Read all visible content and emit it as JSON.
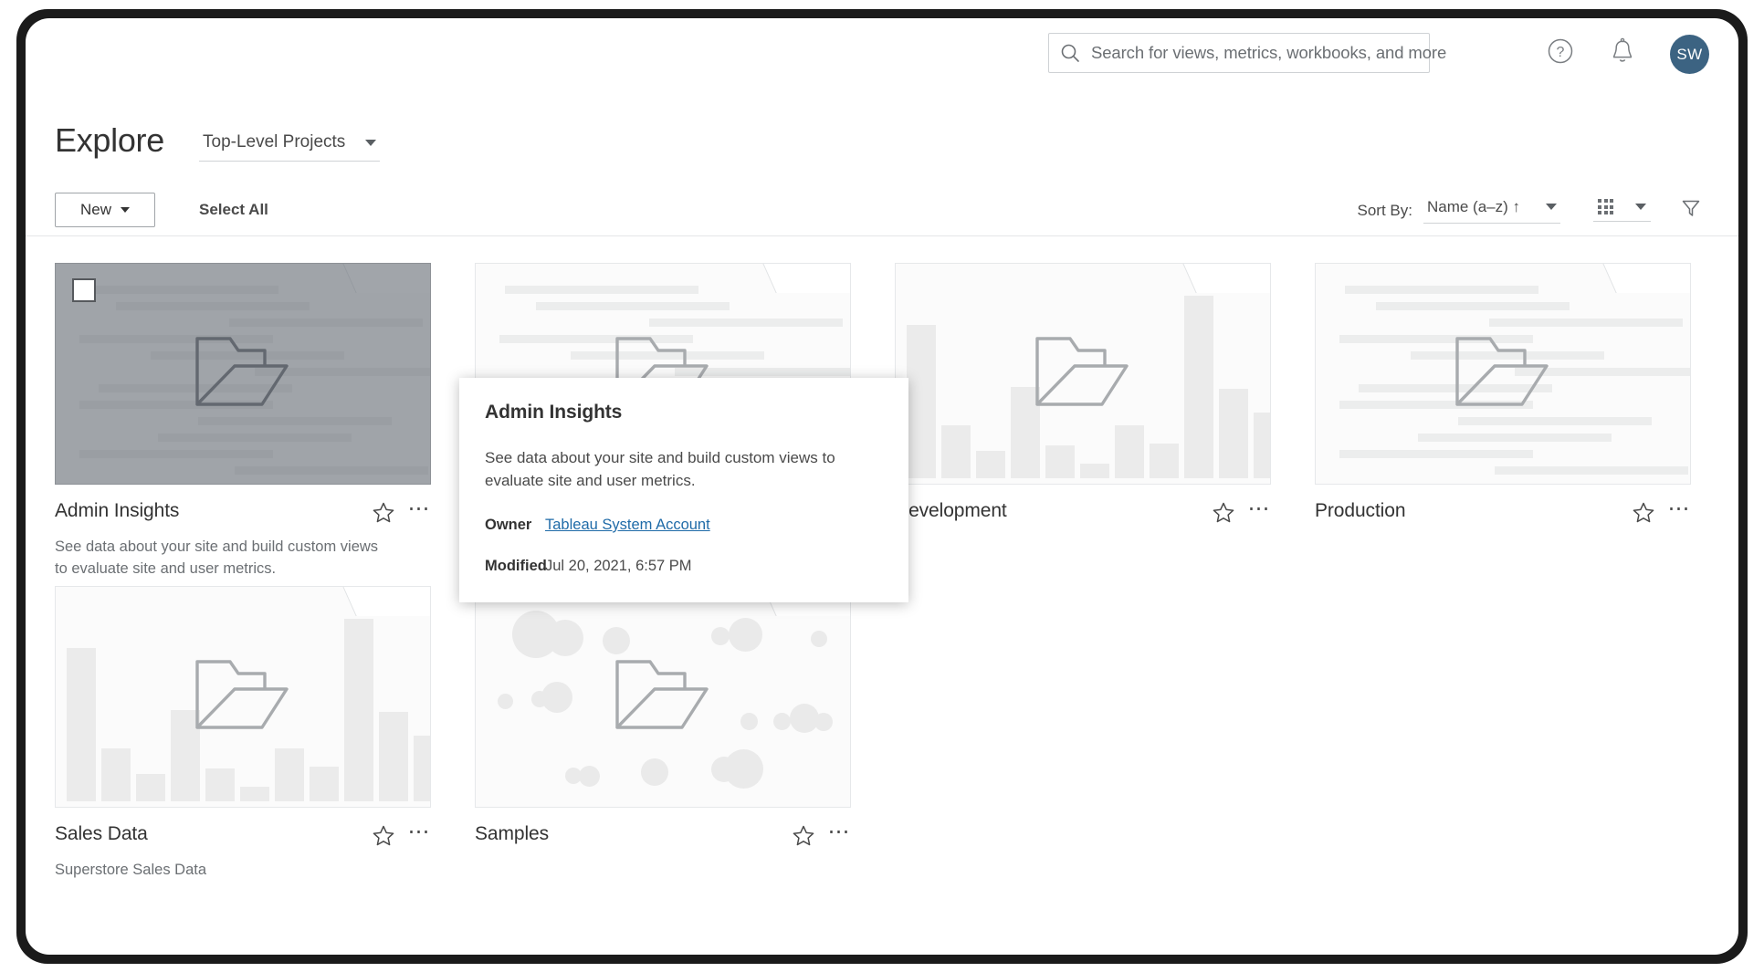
{
  "topbar": {
    "search": {
      "placeholder": "Search for views, metrics, workbooks, and more",
      "icon": "search-icon"
    },
    "help_icon": "help-circle-icon",
    "alerts_icon": "bell-icon",
    "avatar_initials": "SW",
    "avatar_color": "#3c6382"
  },
  "header": {
    "title": "Explore",
    "project_selector": {
      "value": "Top-Level Projects",
      "icon": "chevron-down-icon"
    }
  },
  "toolbar": {
    "new_label": "New",
    "select_all_label": "Select All",
    "sort_label": "Sort By:",
    "sort_value": "Name (a–z) ↑",
    "view_mode_icon": "grid-view-icon",
    "filter_icon": "filter-funnel-icon"
  },
  "cards": [
    {
      "title": "Admin Insights",
      "description": "See data about your site and build custom views to evaluate site and user metrics.",
      "thumbnail": "text-lines",
      "selected": true,
      "star_icon": "star-outline-icon",
      "more_icon": "more-ellipsis-icon"
    },
    {
      "title": "",
      "description": "",
      "thumbnail": "text-lines",
      "selected": false,
      "star_icon": "star-outline-icon",
      "more_icon": "more-ellipsis-icon"
    },
    {
      "title": "Development",
      "description": "",
      "thumbnail": "bar-chart",
      "selected": false,
      "star_icon": "star-outline-icon",
      "more_icon": "more-ellipsis-icon"
    },
    {
      "title": "Production",
      "description": "",
      "thumbnail": "text-lines",
      "selected": false,
      "star_icon": "star-outline-icon",
      "more_icon": "more-ellipsis-icon"
    },
    {
      "title": "Sales Data",
      "description": "Superstore Sales Data",
      "thumbnail": "bar-chart",
      "selected": false,
      "star_icon": "star-outline-icon",
      "more_icon": "more-ellipsis-icon"
    },
    {
      "title": "Samples",
      "description": "",
      "thumbnail": "bubbles",
      "selected": false,
      "star_icon": "star-outline-icon",
      "more_icon": "more-ellipsis-icon"
    }
  ],
  "hovercard": {
    "title": "Admin Insights",
    "description": "See data about your site and build custom views to evaluate site and user metrics.",
    "owner_key": "Owner",
    "owner_value": "Tableau System Account",
    "owner_link_color": "#1f6ba8",
    "modified_key": "Modified",
    "modified_value": "Jul 20, 2021, 6:57 PM"
  }
}
